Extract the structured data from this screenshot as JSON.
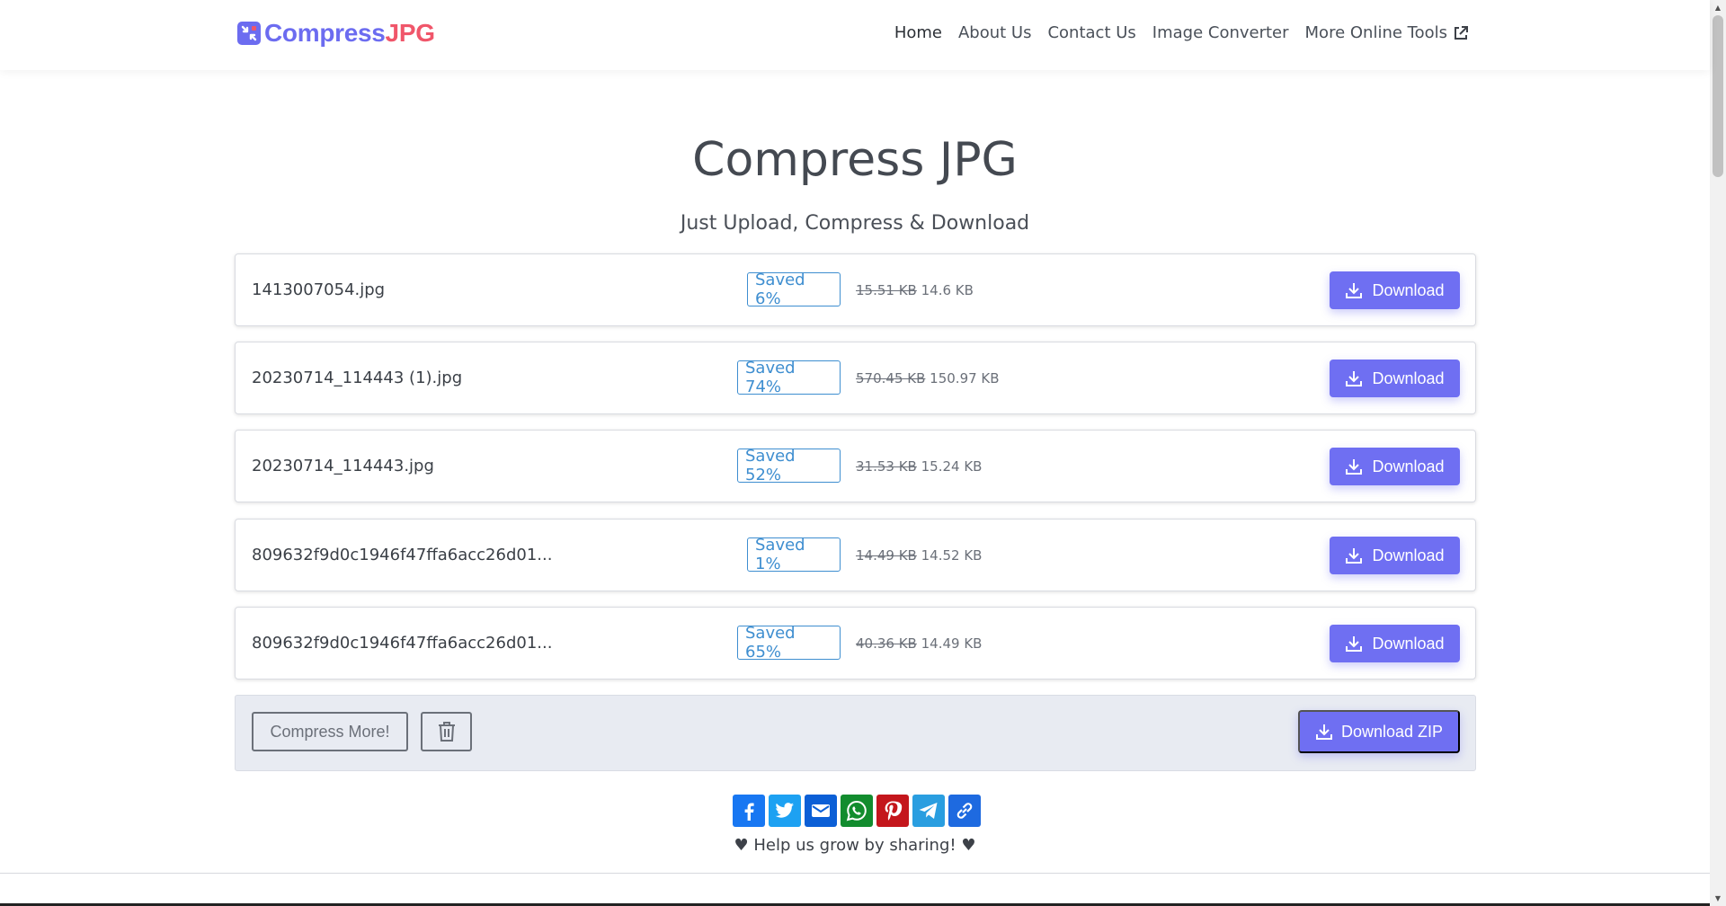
{
  "header": {
    "brand_part1": "Compress",
    "brand_part2": "JPG",
    "nav": [
      {
        "label": "Home",
        "active": true
      },
      {
        "label": "About Us"
      },
      {
        "label": "Contact Us"
      },
      {
        "label": "Image Converter"
      },
      {
        "label": "More Online Tools",
        "icon": "external-link-icon"
      }
    ]
  },
  "main": {
    "title": "Compress JPG",
    "subtitle": "Just Upload, Compress & Download",
    "files": [
      {
        "name": "1413007054.jpg",
        "saved": "Saved 6%",
        "original": "15.51 KB",
        "compressed": "14.6 KB",
        "download": "Download"
      },
      {
        "name": "20230714_114443 (1).jpg",
        "saved": "Saved 74%",
        "original": "570.45 KB",
        "compressed": "150.97 KB",
        "download": "Download"
      },
      {
        "name": "20230714_114443.jpg",
        "saved": "Saved 52%",
        "original": "31.53 KB",
        "compressed": "15.24 KB",
        "download": "Download"
      },
      {
        "name": "809632f9d0c1946f47ffa6acc26d01...",
        "saved": "Saved 1%",
        "original": "14.49 KB",
        "compressed": "14.52 KB",
        "download": "Download"
      },
      {
        "name": "809632f9d0c1946f47ffa6acc26d01...",
        "saved": "Saved 65%",
        "original": "40.36 KB",
        "compressed": "14.49 KB",
        "download": "Download"
      }
    ],
    "actions": {
      "compress_more": "Compress More!",
      "download_zip": "Download ZIP"
    },
    "share": {
      "buttons": [
        {
          "name": "facebook-icon",
          "color": "#1877f2"
        },
        {
          "name": "twitter-icon",
          "color": "#1da1f2"
        },
        {
          "name": "email-icon",
          "color": "#0b5fd6"
        },
        {
          "name": "whatsapp-icon",
          "color": "#128c2e"
        },
        {
          "name": "pinterest-icon",
          "color": "#c4161c"
        },
        {
          "name": "telegram-icon",
          "color": "#2a9ee0"
        },
        {
          "name": "link-icon",
          "color": "#1e6ae0"
        }
      ],
      "text": "Help us grow by sharing!"
    }
  },
  "colors": {
    "accent": "#6f6ff2",
    "brand_red": "#f0566a",
    "saved_badge": "#3e8ed0"
  }
}
